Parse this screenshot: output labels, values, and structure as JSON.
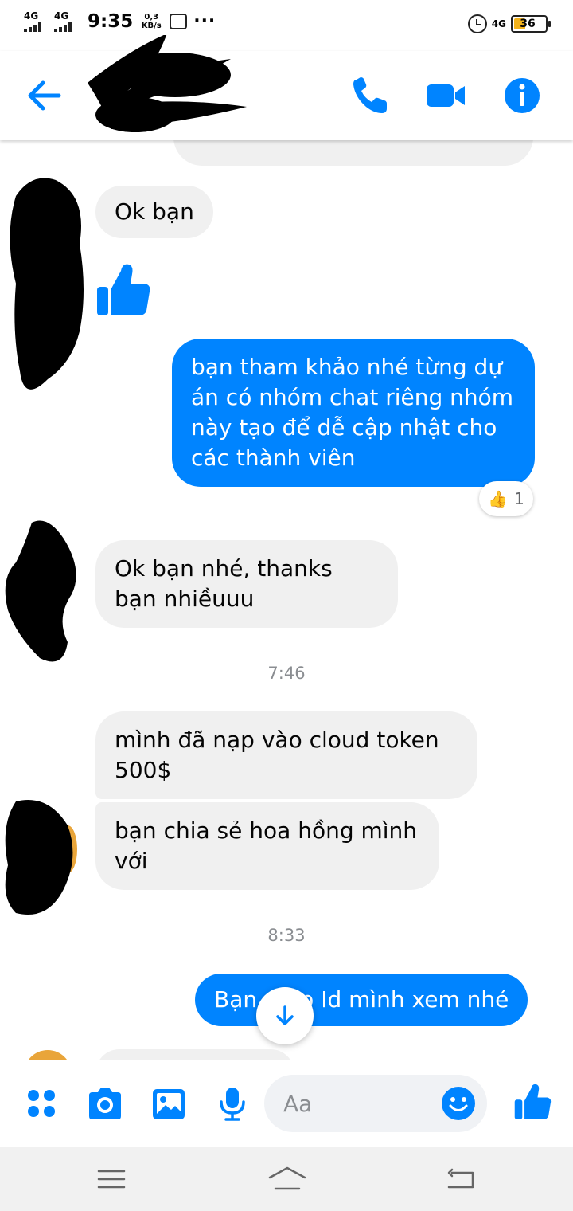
{
  "status_bar": {
    "sim1": "4G",
    "sim2": "4G",
    "time": "9:35",
    "speed_value": "0,3",
    "speed_unit": "KB/s",
    "more": "···",
    "net": "4G",
    "battery": "36"
  },
  "header": {
    "contact_name": ""
  },
  "messages": [
    {
      "side": "in",
      "text": "Ok bạn"
    },
    {
      "side": "out",
      "text": "bạn tham khảo nhé từng dự án có nhóm chat riêng nhóm này tạo để dễ cập nhật cho các thành viên"
    },
    {
      "side": "in",
      "text": "Ok bạn nhé, thanks bạn nhiềuuu"
    },
    {
      "side": "in",
      "text": "mình đã nạp vào cloud token 500$"
    },
    {
      "side": "in",
      "text": "bạn chia sẻ hoa hồng mình với"
    },
    {
      "side": "out",
      "text": "Bạn      p Id mình xem nhé"
    }
  ],
  "reaction": {
    "emoji": "👍",
    "count": "1"
  },
  "timestamps": [
    "7:46",
    "8:33"
  ],
  "composer": {
    "placeholder": "Aa"
  },
  "colors": {
    "accent": "#0084ff",
    "incoming_bubble": "#f0f0f0",
    "outgoing_bubble": "#0084ff"
  }
}
